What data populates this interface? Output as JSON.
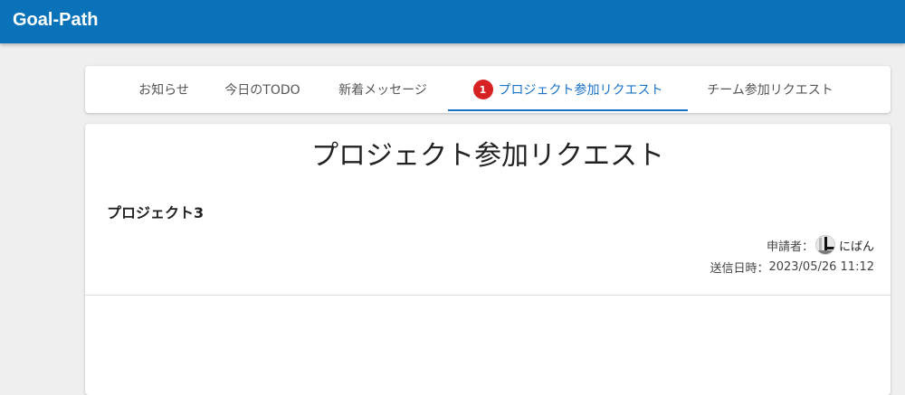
{
  "app": {
    "title": "Goal-Path"
  },
  "tabs": {
    "items": [
      {
        "label": "お知らせ"
      },
      {
        "label": "今日のTODO"
      },
      {
        "label": "新着メッセージ"
      },
      {
        "label": "プロジェクト参加リクエスト",
        "badge": "1",
        "active": true
      },
      {
        "label": "チーム参加リクエスト"
      }
    ]
  },
  "page": {
    "title": "プロジェクト参加リクエスト"
  },
  "request": {
    "project_name": "プロジェクト3",
    "requester_label": "申請者：",
    "requester_name": "にばん",
    "sent_label": "送信日時：",
    "sent_at": "2023/05/26 11:12"
  },
  "colors": {
    "appbar": "#0a72b9",
    "accent": "#1a73c8",
    "badge": "#d62222"
  }
}
